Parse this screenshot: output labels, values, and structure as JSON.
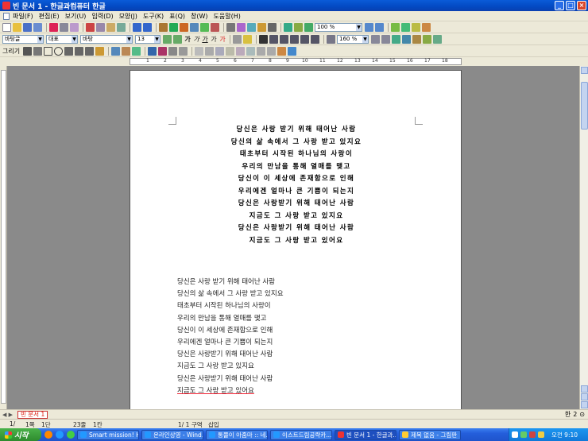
{
  "window": {
    "title": "빈 문서 1 - 한글과컴퓨터 한글",
    "minimize": "_",
    "maximize": "□",
    "close": "×"
  },
  "menu": [
    "파일(F)",
    "편집(E)",
    "보기(U)",
    "입력(D)",
    "모양(J)",
    "도구(K)",
    "표(Q)",
    "창(W)",
    "도움말(H)"
  ],
  "toolbar": {
    "zoom_1": "100 %",
    "style": "바탕글",
    "font_group": "대표",
    "font": "바탕",
    "font_size": "13",
    "zoom_2": "160 %",
    "format_glyphs": [
      "가",
      "가",
      "가",
      "가",
      "가"
    ],
    "draw_label": "그리기"
  },
  "ruler": {
    "marks": [
      "1",
      "2",
      "3",
      "4",
      "5",
      "6",
      "7",
      "8",
      "9",
      "10",
      "11",
      "12",
      "13",
      "14",
      "15",
      "16",
      "17",
      "18"
    ]
  },
  "document": {
    "handwritten_lines": [
      "당신은 사랑 받기 위해 태어난 사람",
      "당신의 삶 속에서 그 사랑 받고 있지요",
      "태초부터 시작된 하나님의 사랑이",
      "우리의 만남을 통해 열매를 맺고",
      "당신이 이 세상에 존재함으로 인해",
      "우리에겐 얼마나 큰 기쁨이 되는지",
      "당신은 사랑받기 위해 태어난 사람",
      "지금도 그 사랑 받고 있지요",
      "당신은 사랑받기 위해 태어난 사람",
      "지금도 그 사랑 받고 있어요"
    ],
    "plain_lines": [
      "당신은 사랑 받기 위해 태어난 사람",
      "당신의 삶 속에서 그 사랑 받고 있지요",
      "태초부터 시작된 하나님의 사랑이",
      "우리의 만남을 통해 열매를 맺고",
      "당신이 이 세상에 존재함으로 인해",
      "우리에겐 얼마나 큰 기쁨이 되는지",
      "당신은 사랑받기 위해 태어난 사람",
      "지금도 그 사랑 받고 있지요",
      "당신은 사랑받기 위해 태어난 사람",
      "지금도 그 사랑 받고 있어요"
    ]
  },
  "tabs": {
    "doc_tab": "빈 문서 1",
    "ime": "한",
    "ime_2": "2",
    "ime_3": "⊙"
  },
  "status": {
    "page": "1/",
    "section": "1쪽",
    "col": "1단",
    "line": "23줄",
    "chars": "1칸",
    "area": "1/  1 구역",
    "mode": "삽입"
  },
  "taskbar": {
    "start": "시작",
    "tasks": [
      "Smart mission! H...",
      "온라인상영 - Wind...",
      "통쫄이 아줌마 :: 네...",
      "이스트드림공략카...",
      "빈 문서 1 - 한글과...",
      "제목 없음 - 그림판"
    ],
    "clock": "오전 9:10"
  }
}
